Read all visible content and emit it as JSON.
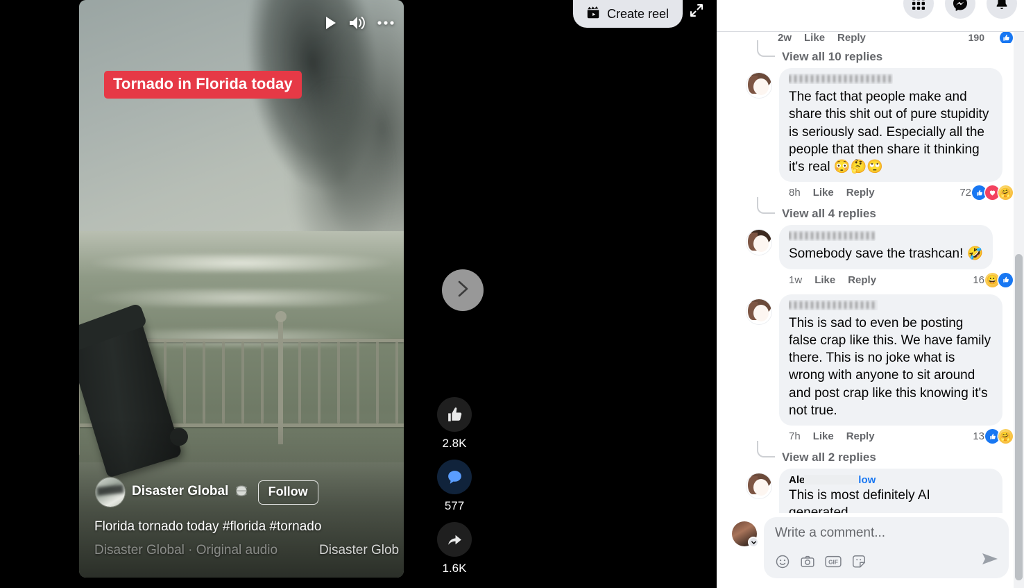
{
  "topbar": {
    "create_reel_label": "Create reel",
    "create_reel_icon": "clapperboard-icon",
    "expand_icon": "expand-icon",
    "nav_icons": [
      "grid-menu-icon",
      "messenger-icon",
      "notifications-bell-icon"
    ]
  },
  "reel": {
    "caption_overlay": "Tornado in Florida today",
    "controls": [
      "play-icon",
      "volume-on-icon",
      "more-options-icon"
    ],
    "author_name": "Disaster Global",
    "privacy_icon": "globe-icon",
    "follow_label": "Follow",
    "description": "Florida tornado today #florida #tornado",
    "audio_attribution": "Disaster Global · Original audio",
    "audio_attribution_repeat": "Disaster Glob",
    "next_button_icon": "chevron-right-icon"
  },
  "reactions": [
    {
      "icon": "thumbs-up-icon",
      "count": "2.8K",
      "name": "like"
    },
    {
      "icon": "comment-bubble-icon",
      "count": "577",
      "name": "comment"
    },
    {
      "icon": "share-arrow-icon",
      "count": "1.6K",
      "name": "share"
    }
  ],
  "comments_panel": {
    "partial_top_comment": {
      "time": "2w",
      "like_label": "Like",
      "reply_label": "Reply",
      "count": "190",
      "reactions": [
        "like"
      ]
    },
    "view_replies_top": "View all 10 replies",
    "comments": [
      {
        "author": "",
        "author_redacted": true,
        "text": "The fact that people make and share this shit out of pure stupidity is seriously sad. Especially all the people that then share it thinking it's real 😳🤔🙄",
        "time": "8h",
        "like_label": "Like",
        "reply_label": "Reply",
        "count": "72",
        "reactions": [
          "like",
          "love",
          "care"
        ],
        "view_replies": "View all 4 replies"
      },
      {
        "author": "",
        "author_redacted": true,
        "text": "Somebody save the trashcan! 🤣",
        "time": "1w",
        "like_label": "Like",
        "reply_label": "Reply",
        "count": "16",
        "reactions": [
          "haha",
          "like"
        ],
        "view_replies": ""
      },
      {
        "author": "",
        "author_redacted": true,
        "text": "This is sad to even be posting false crap like this. We have family there. This is no joke what is wrong with anyone to sit around and post crap like this knowing it's not true.",
        "time": "7h",
        "like_label": "Like",
        "reply_label": "Reply",
        "count": "13",
        "reactions": [
          "like",
          "care"
        ],
        "view_replies": "View all 2 replies"
      },
      {
        "author": "Alexus Ni",
        "author_redacted": true,
        "follow_label": "Follow",
        "text": "This is most definitely AI generated.",
        "time": "",
        "like_label": "",
        "reply_label": "",
        "count": "",
        "reactions": [],
        "view_replies": ""
      }
    ],
    "composer": {
      "placeholder": "Write a comment...",
      "tools": [
        "emoji-icon",
        "camera-icon",
        "gif-icon",
        "sticker-icon"
      ],
      "send_icon": "send-icon"
    }
  },
  "colors": {
    "facebook_blue": "#1877f2",
    "caption_red": "#e63946",
    "bubble_gray": "#f0f2f5",
    "panel_white": "#ffffff",
    "stage_black": "#000000"
  }
}
